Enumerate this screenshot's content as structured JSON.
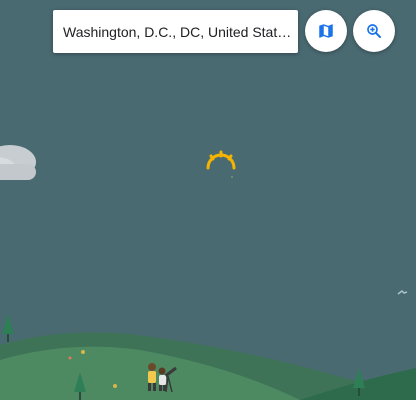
{
  "search": {
    "location": "Washington, D.C., DC, United States"
  },
  "buttons": {
    "map_icon": "map-icon",
    "zoom_icon": "zoom-in-icon"
  },
  "colors": {
    "sky": "#4a6a72",
    "accent": "#1a73e8",
    "sun": "#f4b400"
  }
}
